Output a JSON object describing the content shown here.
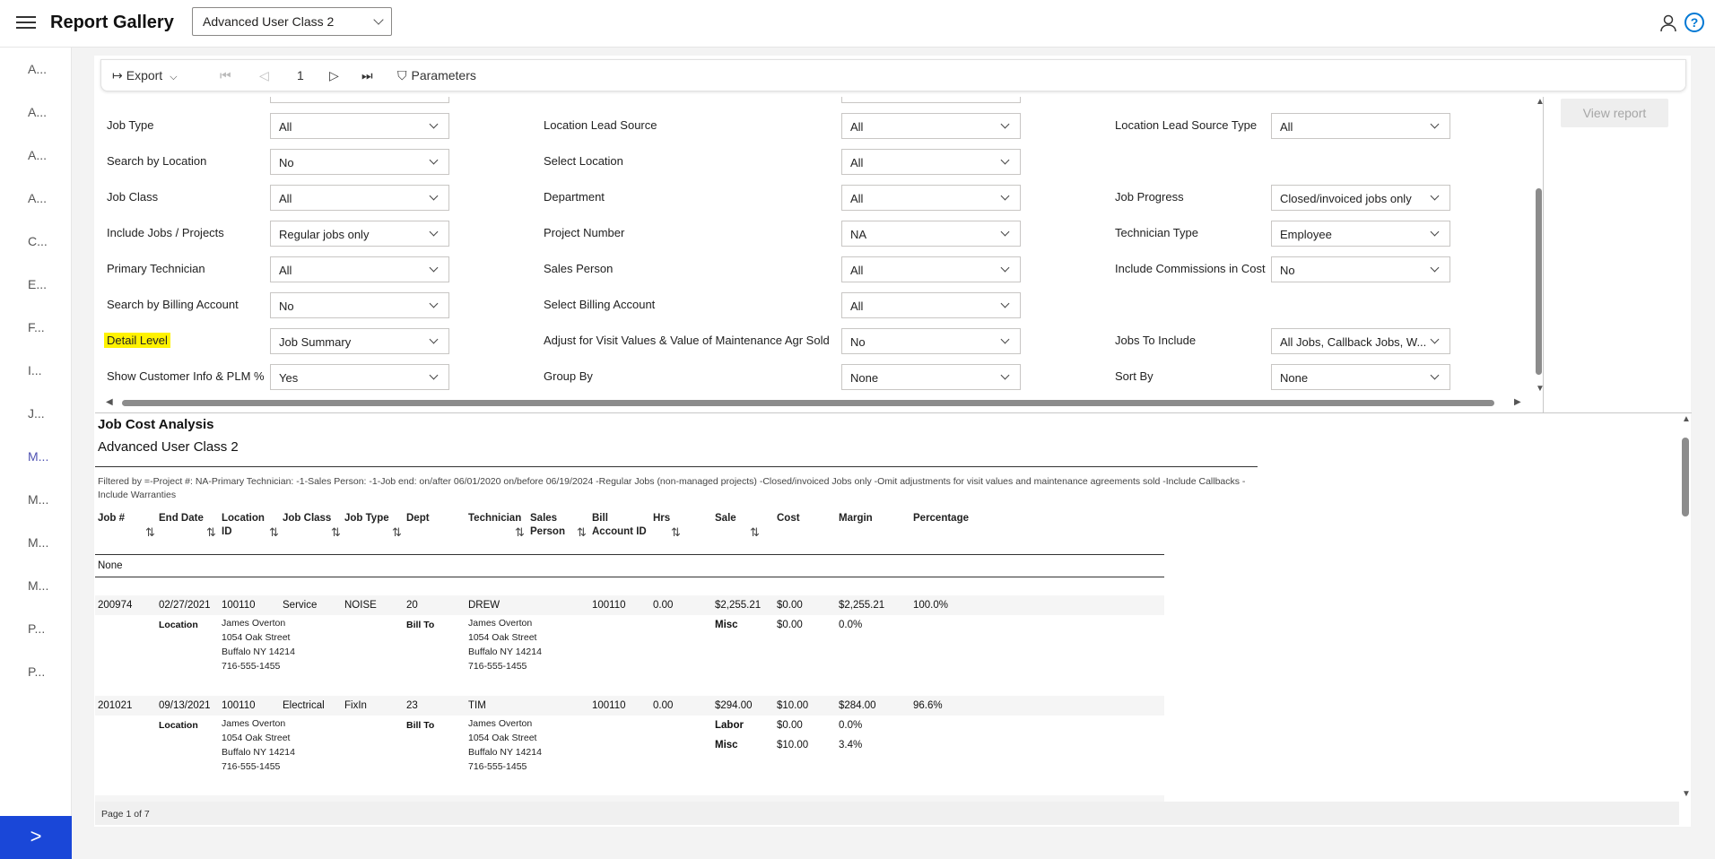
{
  "header": {
    "title": "Report Gallery",
    "selected_report": "Advanced User Class 2"
  },
  "sidebar": {
    "items": [
      "A...",
      "A...",
      "A...",
      "A...",
      "C...",
      "E...",
      "F...",
      "I...",
      "J...",
      "M...",
      "M...",
      "M...",
      "M...",
      "P...",
      "P..."
    ],
    "active_index": 9,
    "expand_glyph": ">"
  },
  "toolbar": {
    "export": "Export",
    "page": "1",
    "parameters": "Parameters"
  },
  "view_report": "View report",
  "params": {
    "col1": [
      {
        "label": "Job Type",
        "value": "All"
      },
      {
        "label": "Search by Location",
        "value": "No"
      },
      {
        "label": "Job Class",
        "value": "All"
      },
      {
        "label": "Include Jobs / Projects",
        "value": "Regular jobs only"
      },
      {
        "label": "Primary Technician",
        "value": "All"
      },
      {
        "label": "Search by Billing Account",
        "value": "No"
      },
      {
        "label": "Detail Level",
        "value": "Job Summary"
      },
      {
        "label": "Show Customer Info & PLM %",
        "value": "Yes"
      }
    ],
    "col2": [
      {
        "label": "Location Lead Source",
        "value": "All"
      },
      {
        "label": "Select Location",
        "value": "All"
      },
      {
        "label": "Department",
        "value": "All"
      },
      {
        "label": "Project Number",
        "value": "NA"
      },
      {
        "label": "Sales Person",
        "value": "All"
      },
      {
        "label": "Select Billing Account",
        "value": "All"
      },
      {
        "label": "Adjust for Visit Values & Value of Maintenance Agr Sold",
        "value": "No"
      },
      {
        "label": "Group By",
        "value": "None"
      }
    ],
    "col3": [
      {
        "label": "Location Lead Source Type",
        "value": "All"
      },
      null,
      {
        "label": "Job Progress",
        "value": "Closed/invoiced jobs only"
      },
      {
        "label": "Technician Type",
        "value": "Employee"
      },
      {
        "label": "Include Commissions in Cost",
        "value": "No"
      },
      null,
      {
        "label": "Jobs To Include",
        "value": "All Jobs, Callback Jobs, W..."
      },
      {
        "label": "Sort By",
        "value": "None"
      }
    ]
  },
  "report": {
    "title": "Job Cost Analysis",
    "subtitle": "Advanced User Class 2",
    "filter": "Filtered by =-Project #: NA-Primary Technician: -1-Sales Person: -1-Job end: on/after 06/01/2020 on/before 06/19/2024 -Regular Jobs (non-managed projects)  -Closed/invoiced Jobs only  -Omit adjustments for visit values and maintenance agreements sold  -Include Callbacks  -Include Warranties",
    "columns": {
      "job": "Job #",
      "end": "End Date",
      "loc1": "Location",
      "loc2": "ID",
      "class": "Job Class",
      "type": "Job Type",
      "dept": "Dept",
      "tech": "Technician",
      "sp1": "Sales",
      "sp2": "Person",
      "ba1": "Bill",
      "ba2": "Account ID",
      "hrs": "Hrs",
      "sale": "Sale",
      "cost": "Cost",
      "margin": "Margin",
      "pct": "Percentage"
    },
    "sort_glyph": "⇅",
    "group": "None",
    "rows": [
      {
        "job": "200974",
        "end": "02/27/2021",
        "loc": "100110",
        "class": "Service",
        "type": "NOISE",
        "dept": "20",
        "tech": "DREW",
        "ba": "100110",
        "hrs": "0.00",
        "sale": "$2,255.21",
        "cost": "$0.00",
        "margin": "$2,255.21",
        "pct": "100.0%",
        "loc_label": "Location",
        "bill_label": "Bill To",
        "address": "James Overton\n1054 Oak Street\nBuffalo NY 14214\n716-555-1455",
        "bill": "James Overton\n1054 Oak Street\nBuffalo NY 14214\n716-555-1455",
        "breakdown": [
          {
            "k": "Misc",
            "cost": "$0.00",
            "pct": "0.0%"
          }
        ]
      },
      {
        "job": "201021",
        "end": "09/13/2021",
        "loc": "100110",
        "class": "Electrical",
        "type": "FixIn",
        "dept": "23",
        "tech": "TIM",
        "ba": "100110",
        "hrs": "0.00",
        "sale": "$294.00",
        "cost": "$10.00",
        "margin": "$284.00",
        "pct": "96.6%",
        "loc_label": "Location",
        "bill_label": "Bill To",
        "address": "James Overton\n1054 Oak Street\nBuffalo NY 14214\n716-555-1455",
        "bill": "James Overton\n1054 Oak Street\nBuffalo NY 14214\n716-555-1455",
        "breakdown": [
          {
            "k": "Labor",
            "cost": "$0.00",
            "pct": "0.0%"
          },
          {
            "k": "Misc",
            "cost": "$10.00",
            "pct": "3.4%"
          }
        ]
      }
    ],
    "footer": "Page 1 of 7"
  }
}
